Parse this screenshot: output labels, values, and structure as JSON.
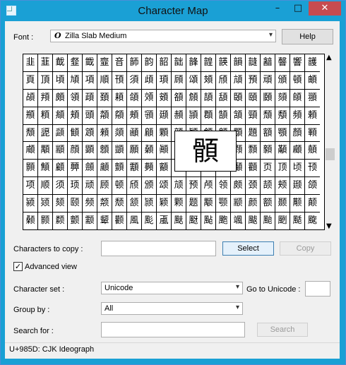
{
  "window": {
    "title": "Character Map",
    "minimize": "–",
    "maximize": "□",
    "close": "✕"
  },
  "font_row": {
    "label": "Font :",
    "font_icon": "O",
    "value": "Zilla Slab Medium",
    "help": "Help"
  },
  "grid_rows": [
    [
      "韭",
      "韮",
      "韯",
      "韰",
      "韱",
      "韲",
      "音",
      "韴",
      "韵",
      "韶",
      "韷",
      "韸",
      "韹",
      "韺",
      "韻",
      "韼",
      "韽",
      "韾",
      "響",
      "頀"
    ],
    [
      "頁",
      "頂",
      "頃",
      "頄",
      "項",
      "順",
      "頇",
      "須",
      "頉",
      "頊",
      "頋",
      "頌",
      "頍",
      "頎",
      "頏",
      "預",
      "頑",
      "頒",
      "頓",
      "頔"
    ],
    [
      "頕",
      "頖",
      "頗",
      "領",
      "頙",
      "頚",
      "頛",
      "頜",
      "頝",
      "頞",
      "頟",
      "頠",
      "頡",
      "頢",
      "頣",
      "頤",
      "頥",
      "頦",
      "頧",
      "頨"
    ],
    [
      "頩",
      "頪",
      "頫",
      "頬",
      "頭",
      "頮",
      "頯",
      "頰",
      "頱",
      "頲",
      "頳",
      "頴",
      "頵",
      "頶",
      "頷",
      "頸",
      "頹",
      "頺",
      "頻",
      "頼"
    ],
    [
      "頽",
      "頾",
      "頿",
      "顀",
      "顁",
      "顂",
      "顃",
      "顄",
      "顅",
      "顆",
      "顇",
      "顈",
      "顉",
      "顊",
      "顋",
      "題",
      "額",
      "顎",
      "顏",
      "顐"
    ],
    [
      "顑",
      "顒",
      "顓",
      "顔",
      "顕",
      "顖",
      "顗",
      "願",
      "顙",
      "顚",
      "顛",
      "顜",
      "顝",
      "類",
      "顟",
      "顠",
      "顡",
      "顢",
      "顣",
      "顤"
    ],
    [
      "顥",
      "顦",
      "顧",
      "顨",
      "顩",
      "顪",
      "顫",
      "顬",
      "顭",
      "顮",
      "顯",
      "顰",
      "顱",
      "顲",
      "顳",
      "顴",
      "页",
      "顶",
      "顷",
      "顸"
    ],
    [
      "项",
      "顺",
      "须",
      "顼",
      "顽",
      "顾",
      "顿",
      "颀",
      "颁",
      "颂",
      "颃",
      "预",
      "颅",
      "领",
      "颇",
      "颈",
      "颉",
      "颊",
      "颋",
      "颌"
    ],
    [
      "颍",
      "颎",
      "颏",
      "颐",
      "频",
      "颒",
      "颓",
      "颔",
      "颕",
      "颖",
      "颗",
      "题",
      "颙",
      "颚",
      "颛",
      "颜",
      "额",
      "颞",
      "颟",
      "颠"
    ],
    [
      "颡",
      "颢",
      "颣",
      "颤",
      "颥",
      "颦",
      "颧",
      "風",
      "颩",
      "颪",
      "颫",
      "颬",
      "颭",
      "颮",
      "颯",
      "颰",
      "颱",
      "颲",
      "颳",
      "颴"
    ]
  ],
  "zoom_char": "顝",
  "copy_row": {
    "label": "Characters to copy :",
    "value": "",
    "select": "Select",
    "copy": "Copy"
  },
  "advanced": {
    "label": "Advanced view",
    "checked": "✓"
  },
  "charset_row": {
    "label": "Character set :",
    "value": "Unicode",
    "goto_label": "Go to Unicode :",
    "goto_value": ""
  },
  "group_row": {
    "label": "Group by :",
    "value": "All"
  },
  "search_row": {
    "label": "Search for :",
    "value": "",
    "button": "Search"
  },
  "status": "U+985D: CJK Ideograph",
  "colors": {
    "titlebar": "#1aa0d5",
    "close": "#c74b50",
    "client": "#f0f0f0"
  }
}
